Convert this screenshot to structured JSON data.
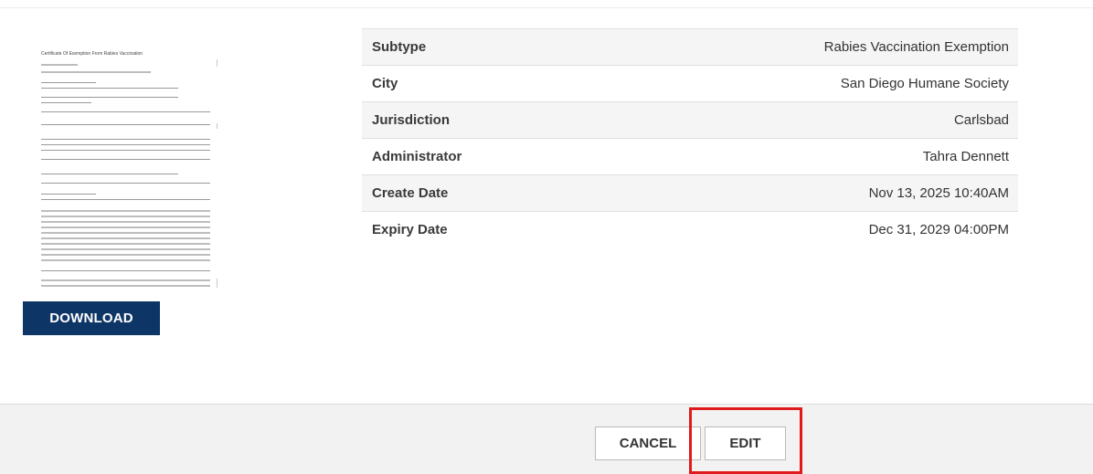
{
  "document": {
    "title": "Certificate Of Exemption From Rabies Vaccination"
  },
  "download_label": "DOWNLOAD",
  "details": [
    {
      "label": "Subtype",
      "value": "Rabies Vaccination Exemption"
    },
    {
      "label": "City",
      "value": "San Diego Humane Society"
    },
    {
      "label": "Jurisdiction",
      "value": "Carlsbad"
    },
    {
      "label": "Administrator",
      "value": "Tahra Dennett"
    },
    {
      "label": "Create Date",
      "value": "Nov 13, 2025 10:40AM"
    },
    {
      "label": "Expiry Date",
      "value": "Dec 31, 2029 04:00PM"
    }
  ],
  "footer": {
    "cancel_label": "CANCEL",
    "edit_label": "EDIT"
  },
  "colors": {
    "primary": "#0d3566",
    "highlight": "#e01b1b"
  }
}
